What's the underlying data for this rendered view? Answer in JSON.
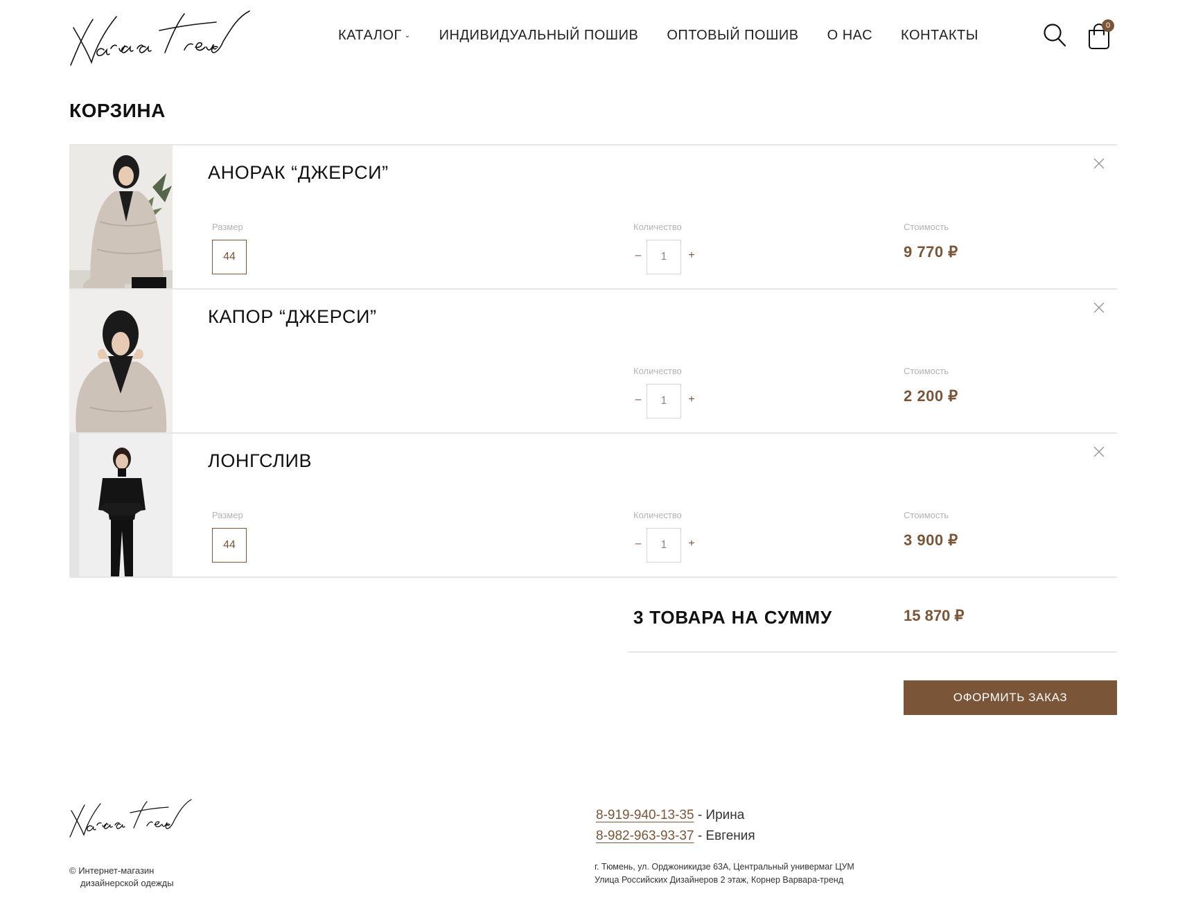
{
  "brand": {
    "logo_text": "Varvara trend"
  },
  "nav": {
    "items": [
      {
        "label": "КАТАЛОГ",
        "dropdown": true
      },
      {
        "label": "ИНДИВИДУАЛЬНЫЙ ПОШИВ"
      },
      {
        "label": "ОПТОВЫЙ ПОШИВ"
      },
      {
        "label": "О НАС"
      },
      {
        "label": "КОНТАКТЫ"
      }
    ],
    "cart_count": "0"
  },
  "page": {
    "title": "КОРЗИНА"
  },
  "cart": {
    "size_label": "Размер",
    "quantity_label": "Количество",
    "cost_label": "Стоимость",
    "items": [
      {
        "name": "АНОРАК “ДЖЕРСИ”",
        "size": "44",
        "quantity": "1",
        "price": "9 770 ₽"
      },
      {
        "name": "КАПОР “ДЖЕРСИ”",
        "size": "",
        "quantity": "1",
        "price": "2 200 ₽"
      },
      {
        "name": "ЛОНГСЛИВ",
        "size": "44",
        "quantity": "1",
        "price": "3 900 ₽"
      }
    ],
    "summary_label": "3 ТОВАРА НА СУММУ",
    "summary_total": "15 870 ₽",
    "order_button": "ОФОРМИТЬ ЗАКАЗ"
  },
  "footer": {
    "copyright_line1": "© Интернет-магазин",
    "copyright_line2": "дизайнерской одежды",
    "phones": [
      {
        "number": "8-919-940-13-35",
        "name": " - Ирина"
      },
      {
        "number": "8-982-963-93-37",
        "name": " - Евгения"
      }
    ],
    "address_line1": "г. Тюмень, ул. Орджоникидзе 63А, Центральный универмаг ЦУМ",
    "address_line2": "Улица Российских Дизайнеров 2 этаж, Корнер Варвара-тренд"
  },
  "colors": {
    "accent": "#7b5537",
    "divider": "#e6e6e6",
    "label": "#b3b3b3"
  },
  "icons": [
    "search-icon",
    "cart-icon",
    "close-icon",
    "chevron-down-icon"
  ]
}
